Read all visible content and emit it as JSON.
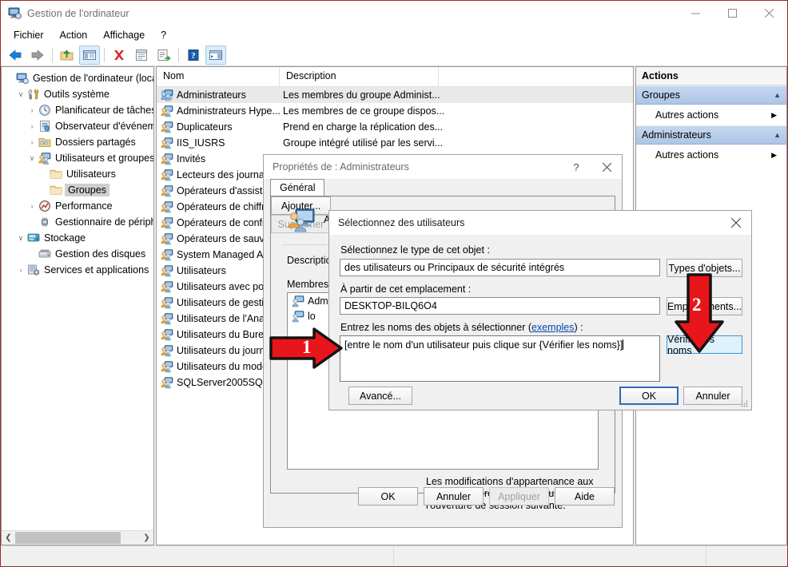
{
  "window": {
    "title": "Gestion de l'ordinateur",
    "icon": "computer-management-icon",
    "minimize": "–",
    "maximize": "□",
    "close": "✕"
  },
  "menu": {
    "items": [
      {
        "label": "Fichier",
        "name": "menu-fichier"
      },
      {
        "label": "Action",
        "name": "menu-action"
      },
      {
        "label": "Affichage",
        "name": "menu-affichage"
      },
      {
        "label": "?",
        "name": "menu-help"
      }
    ]
  },
  "toolbar": {
    "buttons": [
      {
        "name": "back-icon",
        "glyph": "back"
      },
      {
        "name": "forward-icon",
        "glyph": "forward"
      },
      {
        "name": "up-folder-icon",
        "glyph": "upfolder"
      },
      {
        "name": "show-hide-console-tree-icon",
        "glyph": "consoletree",
        "pressed": true
      },
      {
        "name": "delete-icon",
        "glyph": "delete"
      },
      {
        "name": "properties-icon",
        "glyph": "properties"
      },
      {
        "name": "export-list-icon",
        "glyph": "export"
      },
      {
        "name": "help-icon",
        "glyph": "help"
      },
      {
        "name": "show-action-pane-icon",
        "glyph": "actionpane",
        "pressed": true
      }
    ]
  },
  "tree": {
    "nodes": [
      {
        "label": "Gestion de l'ordinateur (local)",
        "indent": 0,
        "twist": "",
        "icon": "computer-icon"
      },
      {
        "label": "Outils système",
        "indent": 1,
        "twist": "∨",
        "icon": "tools-icon"
      },
      {
        "label": "Planificateur de tâches",
        "indent": 2,
        "twist": "›",
        "icon": "clock-icon"
      },
      {
        "label": "Observateur d'événements",
        "indent": 2,
        "twist": "›",
        "icon": "eventviewer-icon"
      },
      {
        "label": "Dossiers partagés",
        "indent": 2,
        "twist": "›",
        "icon": "sharedfolders-icon"
      },
      {
        "label": "Utilisateurs et groupes l",
        "indent": 2,
        "twist": "∨",
        "icon": "users-groups-icon"
      },
      {
        "label": "Utilisateurs",
        "indent": 3,
        "twist": "",
        "icon": "folder-icon"
      },
      {
        "label": "Groupes",
        "indent": 3,
        "twist": "",
        "icon": "folder-icon",
        "selected": true
      },
      {
        "label": "Performance",
        "indent": 2,
        "twist": "›",
        "icon": "performance-icon"
      },
      {
        "label": "Gestionnaire de périphé",
        "indent": 2,
        "twist": "",
        "icon": "devicemanager-icon"
      },
      {
        "label": "Stockage",
        "indent": 1,
        "twist": "∨",
        "icon": "storage-icon"
      },
      {
        "label": "Gestion des disques",
        "indent": 2,
        "twist": "",
        "icon": "disk-icon"
      },
      {
        "label": "Services et applications",
        "indent": 1,
        "twist": "›",
        "icon": "services-icon"
      }
    ]
  },
  "list": {
    "columns": [
      "Nom",
      "Description"
    ],
    "rows": [
      {
        "name": "Administrateurs",
        "desc": "Les membres du groupe Administ...",
        "selected": true,
        "icon": "group-selected-icon"
      },
      {
        "name": "Administrateurs Hype...",
        "desc": "Les membres de ce groupe dispos...",
        "icon": "group-icon"
      },
      {
        "name": "Duplicateurs",
        "desc": "Prend en charge la réplication des...",
        "icon": "group-icon"
      },
      {
        "name": "IIS_IUSRS",
        "desc": "Groupe intégré utilisé par les servi...",
        "icon": "group-icon"
      },
      {
        "name": "Invités",
        "desc": "",
        "icon": "group-icon"
      },
      {
        "name": "Lecteurs des journau",
        "desc": "",
        "icon": "group-icon"
      },
      {
        "name": "Opérateurs d'assistan",
        "desc": "",
        "icon": "group-icon"
      },
      {
        "name": "Opérateurs de chiffre",
        "desc": "",
        "icon": "group-icon"
      },
      {
        "name": "Opérateurs de config",
        "desc": "",
        "icon": "group-icon"
      },
      {
        "name": "Opérateurs de sauveɡ",
        "desc": "",
        "icon": "group-icon"
      },
      {
        "name": "System Managed Ac",
        "desc": "",
        "icon": "group-icon"
      },
      {
        "name": "Utilisateurs",
        "desc": "",
        "icon": "group-icon"
      },
      {
        "name": "Utilisateurs avec pou",
        "desc": "",
        "icon": "group-icon"
      },
      {
        "name": "Utilisateurs de gestio",
        "desc": "",
        "icon": "group-icon"
      },
      {
        "name": "Utilisateurs de l'Analy",
        "desc": "",
        "icon": "group-icon"
      },
      {
        "name": "Utilisateurs du Burea",
        "desc": "",
        "icon": "group-icon"
      },
      {
        "name": "Utilisateurs du journa",
        "desc": "",
        "icon": "group-icon"
      },
      {
        "name": "Utilisateurs du modè",
        "desc": "",
        "icon": "group-icon"
      },
      {
        "name": "SQLServer2005SQLBr",
        "desc": "",
        "icon": "group-icon"
      }
    ]
  },
  "actions": {
    "header": "Actions",
    "groups": [
      {
        "title": "Groupes",
        "caret": "▲",
        "items": [
          {
            "label": "Autres actions",
            "caret": "▶"
          }
        ]
      },
      {
        "title": "Administrateurs",
        "caret": "▲",
        "items": [
          {
            "label": "Autres actions",
            "caret": "▶"
          }
        ]
      }
    ]
  },
  "properties_dialog": {
    "title": "Propriétés de : Administrateurs",
    "help_btn": "?",
    "close_btn": "✕",
    "tab": "Général",
    "group_name": "Ad",
    "description_label": "Description :",
    "members_label": "Membres :",
    "members": [
      {
        "name": "Administ",
        "icon": "user-icon"
      },
      {
        "name": "lo",
        "icon": "user-icon"
      }
    ],
    "add_button": "Ajouter...",
    "remove_button": "Supprimer",
    "note": "Les modifications d'appartenance aux groupes ne prennent effet qu'à l'ouverture de session suivante.",
    "ok_button": "OK",
    "cancel_button": "Annuler",
    "apply_button": "Appliquer",
    "help_button": "Aide"
  },
  "select_users_dialog": {
    "title": "Sélectionnez des utilisateurs",
    "close_btn": "✕",
    "object_type_label": "Sélectionnez le type de cet objet :",
    "object_type_value": "des utilisateurs ou Principaux de sécurité intégrés",
    "object_types_button": "Types d'objets...",
    "location_label": "À partir de cet emplacement :",
    "location_value": "DESKTOP-BILQ6O4",
    "locations_button": "Emplacements...",
    "names_label_pre": "Entrez les noms des objets à sélectionner (",
    "names_label_link": "exemples",
    "names_label_post": ") :",
    "names_value": "[entre le nom d'un utilisateur puis clique sur {Vérifier les noms}]",
    "check_names_button": "Vérifier les noms",
    "advanced_button": "Avancé...",
    "ok_button": "OK",
    "cancel_button": "Annuler"
  },
  "annotations": [
    {
      "number": "1",
      "direction": "right",
      "name": "annotation-arrow-1"
    },
    {
      "number": "2",
      "direction": "down",
      "name": "annotation-arrow-2"
    }
  ],
  "colors": {
    "annotation_red": "#e8161a",
    "annotation_outline": "#1a1a1a",
    "accent_blue": "#2a6bb5",
    "link_blue": "#0645ad",
    "action_group_blue": "#aec5e5"
  }
}
